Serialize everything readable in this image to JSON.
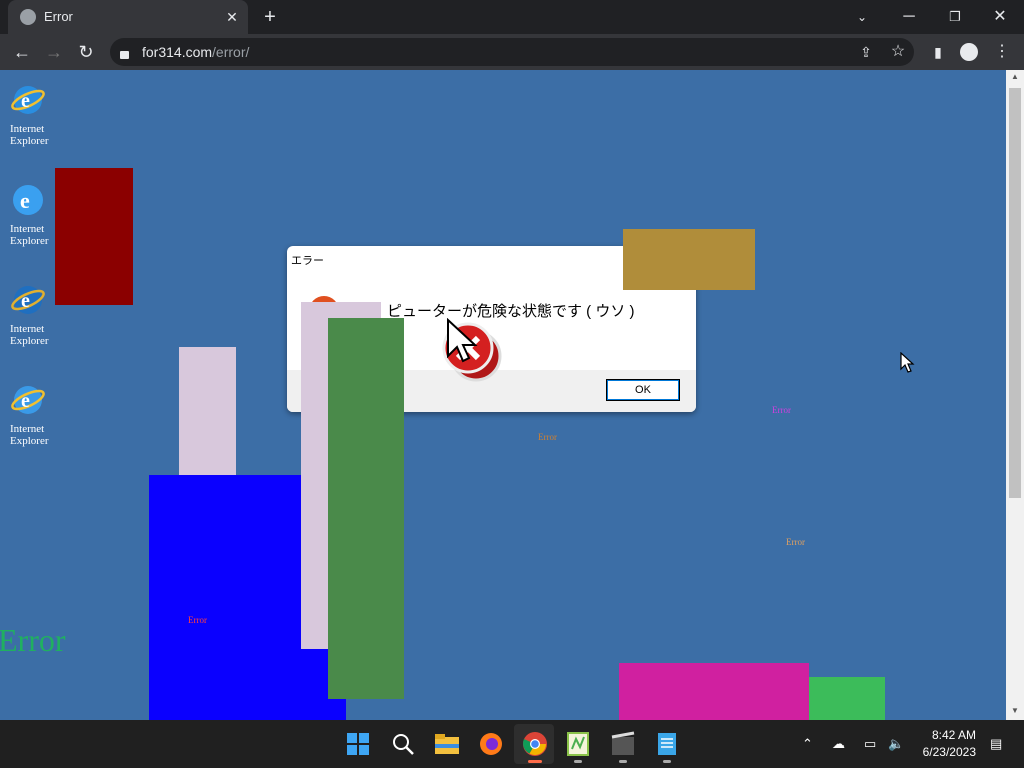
{
  "browser": {
    "tab_title": "Error",
    "url_host": "for314.com",
    "url_path": "/error/"
  },
  "desktop_icons": [
    {
      "label_line1": "Internet",
      "label_line2": "Explorer"
    },
    {
      "label_line1": "Internet",
      "label_line2": "Explorer"
    },
    {
      "label_line1": "Internet",
      "label_line2": "Explorer"
    },
    {
      "label_line1": "Internet",
      "label_line2": "Explorer"
    }
  ],
  "error_texts": {
    "big": "Error",
    "small": "Error"
  },
  "dialog": {
    "title": "エラー",
    "message": "ピューターが危険な状態です ( ウソ )",
    "ok_label": "OK"
  },
  "taskbar": {
    "time": "8:42 AM",
    "date": "6/23/2023"
  },
  "colors": {
    "page_bg": "#3c6ea6",
    "dark_red": "#8b0000",
    "tan": "#b08d3a",
    "lavender": "#d8c8dc",
    "green": "#4a8a4a",
    "blue": "#0a00ff",
    "magenta": "#d020a0",
    "bright_green": "#3cbc5a"
  }
}
